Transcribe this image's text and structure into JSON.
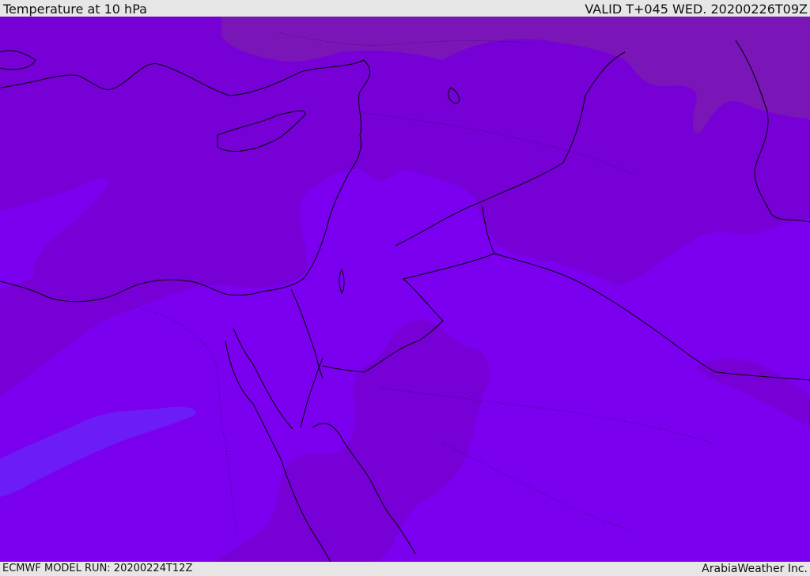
{
  "header": {
    "title": "Temperature at 10 hPa",
    "valid": "VALID T+045 WED. 20200226T09Z"
  },
  "footer": {
    "model_run": "ECMWF MODEL RUN: 20200224T12Z",
    "credit": "ArabiaWeather Inc."
  },
  "colors": {
    "background_fill": "#7b00f0",
    "warm_band": "#7600d6",
    "warmest_band": "#7a16b8",
    "cold_band": "#6c1df7",
    "coastline": "#000000"
  }
}
